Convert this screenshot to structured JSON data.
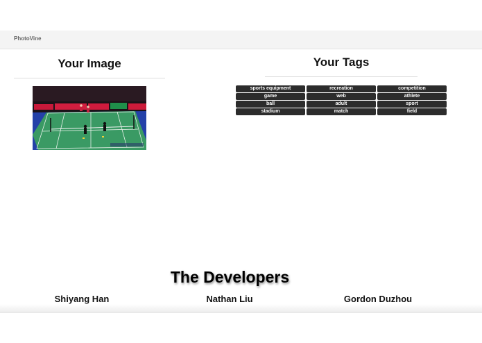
{
  "navbar": {
    "brand": "PhotoVine"
  },
  "image_section": {
    "title": "Your Image",
    "photo_alt": "badminton doubles match on a green court"
  },
  "tags_section": {
    "title": "Your Tags",
    "tags": [
      "sports equipment",
      "recreation",
      "competition",
      "game",
      "web",
      "athlete",
      "ball",
      "adult",
      "sport",
      "stadium",
      "match",
      "field"
    ]
  },
  "developers": {
    "title": "The Developers",
    "names": [
      "Shiyang Han",
      "Nathan Liu",
      "Gordon Duzhou"
    ]
  }
}
